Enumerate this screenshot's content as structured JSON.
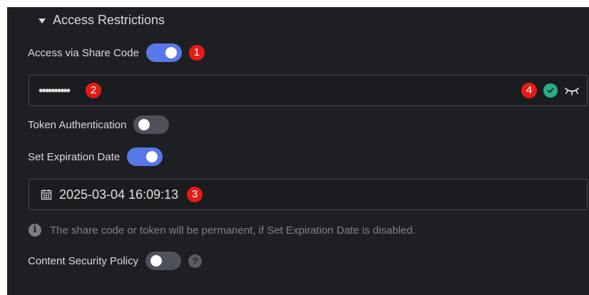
{
  "section": {
    "title": "Access Restrictions",
    "expanded": true
  },
  "share_code": {
    "label": "Access via Share Code",
    "enabled": true,
    "marker": "1"
  },
  "password": {
    "value": "••••••••••",
    "marker": "2",
    "status_marker": "4",
    "status": "valid",
    "icons": [
      "check-circle-icon",
      "eye-closed-icon"
    ]
  },
  "token_auth": {
    "label": "Token Authentication",
    "enabled": false
  },
  "expiration": {
    "label": "Set Expiration Date",
    "enabled": true
  },
  "date_field": {
    "value": "2025-03-04 16:09:13",
    "marker": "3",
    "icon": "calendar-icon"
  },
  "hint": {
    "icon": "info-icon",
    "info_glyph": "i",
    "text": "The share code or token will be permanent, if Set Expiration Date is disabled."
  },
  "csp": {
    "label": "Content Security Policy",
    "enabled": false,
    "help_glyph": "?"
  },
  "colors": {
    "background": "#1e1f22",
    "toggle_on": "#5878e8",
    "toggle_off": "#4e505a",
    "marker": "#e51c15",
    "valid": "#26b08a"
  }
}
